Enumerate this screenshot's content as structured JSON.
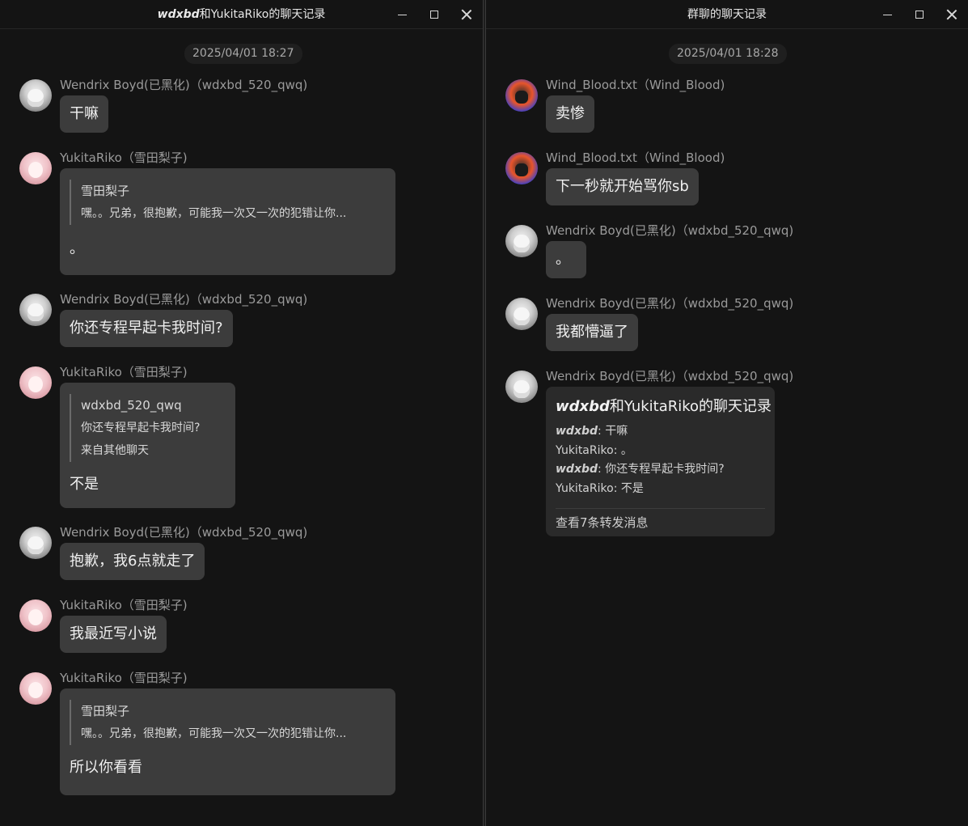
{
  "left_window": {
    "title_prefix": "wdxbd",
    "title_suffix": "和YukitaRiko的聊天记录",
    "timestamp": "2025/04/01 18:27",
    "messages": [
      {
        "sender": "Wendrix Boyd(已黑化)（wdxbd_520_qwq)",
        "avatar": "wendrix-avatar",
        "text": "干嘛"
      },
      {
        "sender": "YukitaRiko（雪田梨子)",
        "avatar": "yukita-avatar",
        "quote_author": "雪田梨子",
        "quote_text": "嘿。。兄弟，很抱歉，可能我一次又一次的犯错让你...",
        "text": "。"
      },
      {
        "sender": "Wendrix Boyd(已黑化)（wdxbd_520_qwq)",
        "avatar": "wendrix-avatar",
        "text": "你还专程早起卡我时间?"
      },
      {
        "sender": "YukitaRiko（雪田梨子)",
        "avatar": "yukita-avatar",
        "quote_author": "wdxbd_520_qwq",
        "quote_text": "你还专程早起卡我时间?",
        "quote_extra": "来自其他聊天",
        "text": "不是"
      },
      {
        "sender": "Wendrix Boyd(已黑化)（wdxbd_520_qwq)",
        "avatar": "wendrix-avatar",
        "text": "抱歉，我6点就走了"
      },
      {
        "sender": "YukitaRiko（雪田梨子)",
        "avatar": "yukita-avatar",
        "text": "我最近写小说"
      },
      {
        "sender": "YukitaRiko（雪田梨子)",
        "avatar": "yukita-avatar",
        "quote_author": "雪田梨子",
        "quote_text": "嘿。。兄弟，很抱歉，可能我一次又一次的犯错让你...",
        "text": "所以你看看"
      }
    ]
  },
  "right_window": {
    "title": "群聊的聊天记录",
    "timestamp": "2025/04/01 18:28",
    "messages": [
      {
        "sender": "Wind_Blood.txt（Wind_Blood)",
        "avatar": "wind-blood-avatar",
        "text": "卖惨"
      },
      {
        "sender": "Wind_Blood.txt（Wind_Blood)",
        "avatar": "wind-blood-avatar",
        "text": "下一秒就开始骂你sb"
      },
      {
        "sender": "Wendrix Boyd(已黑化)（wdxbd_520_qwq)",
        "avatar": "wendrix-avatar",
        "text": "。"
      },
      {
        "sender": "Wendrix Boyd(已黑化)（wdxbd_520_qwq)",
        "avatar": "wendrix-avatar",
        "text": "我都懵逼了"
      },
      {
        "sender": "Wendrix Boyd(已黑化)（wdxbd_520_qwq)",
        "avatar": "wendrix-avatar",
        "forward": {
          "title_prefix": "wdxbd",
          "title_suffix": "和YukitaRiko的聊天记录",
          "lines": [
            {
              "speaker": "wdxbd",
              "text": ": 干嘛"
            },
            {
              "speaker": "YukitaRiko",
              "text": ": 。"
            },
            {
              "speaker": "wdxbd",
              "text": ": 你还专程早起卡我时间?"
            },
            {
              "speaker": "YukitaRiko",
              "text": ": 不是"
            }
          ],
          "footer": "查看7条转发消息"
        }
      }
    ]
  },
  "colors": {
    "window_bg": "#141414",
    "bubble_bg": "#3c3c3c",
    "card_bg": "#2a2a2a",
    "sender_text": "#9a9a9a"
  }
}
